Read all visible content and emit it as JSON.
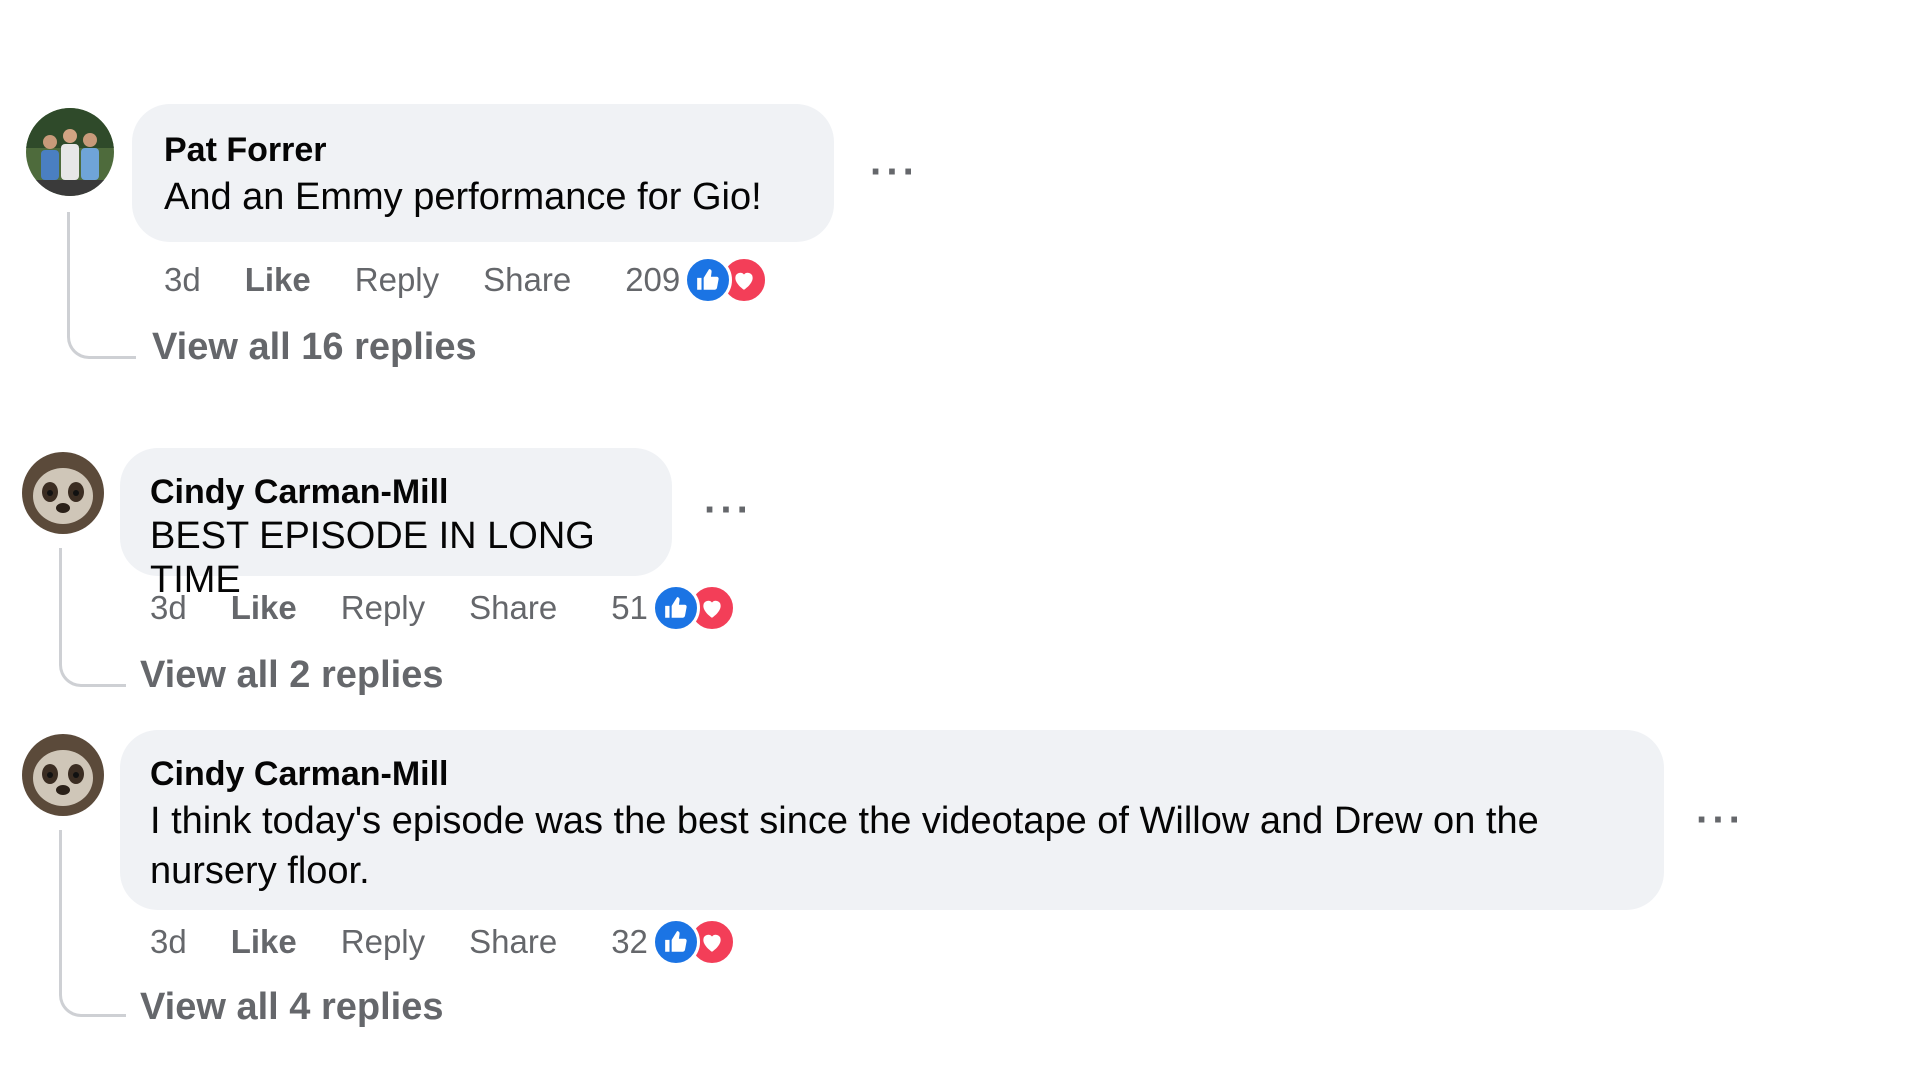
{
  "comments": [
    {
      "author": "Pat Forrer",
      "text": "And an Emmy performance for Gio!",
      "time": "3d",
      "like_label": "Like",
      "reply_label": "Reply",
      "share_label": "Share",
      "reaction_count": "209",
      "reactions": [
        "like-icon",
        "love-icon"
      ],
      "view_replies": "View all 16 replies",
      "more_label": "···"
    },
    {
      "author": "Cindy Carman-Mill",
      "text": "BEST EPISODE IN LONG TIME",
      "time": "3d",
      "like_label": "Like",
      "reply_label": "Reply",
      "share_label": "Share",
      "reaction_count": "51",
      "reactions": [
        "like-icon",
        "love-icon"
      ],
      "view_replies": "View all 2 replies",
      "more_label": "···"
    },
    {
      "author": "Cindy Carman-Mill",
      "text": "I think today's episode was the best since the videotape of Willow and Drew on the nursery floor.",
      "time": "3d",
      "like_label": "Like",
      "reply_label": "Reply",
      "share_label": "Share",
      "reaction_count": "32",
      "reactions": [
        "like-icon",
        "love-icon"
      ],
      "view_replies": "View all 4 replies",
      "more_label": "···"
    }
  ],
  "colors": {
    "bubble": "#f0f2f5",
    "secondary_text": "#65676b",
    "like_blue": "#1b74e4",
    "love_red": "#f33e58"
  }
}
